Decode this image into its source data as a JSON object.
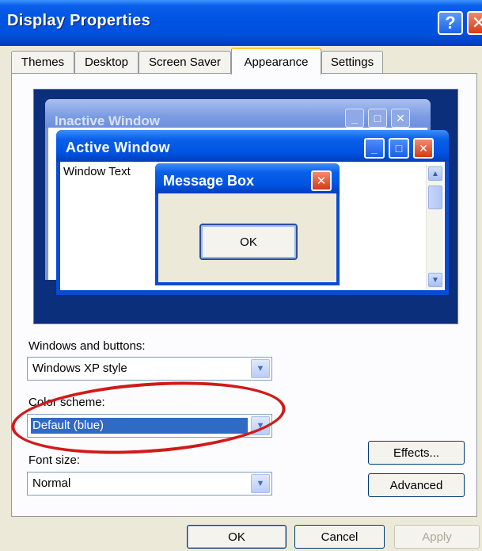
{
  "window": {
    "title": "Display Properties",
    "help_glyph": "?",
    "close_glyph": "✕"
  },
  "tabs": [
    {
      "label": "Themes"
    },
    {
      "label": "Desktop"
    },
    {
      "label": "Screen Saver"
    },
    {
      "label": "Appearance",
      "active": true
    },
    {
      "label": "Settings"
    }
  ],
  "preview": {
    "inactive_window_title": "Inactive Window",
    "active_window_title": "Active Window",
    "window_text": "Window Text",
    "message_box_title": "Message Box",
    "message_box_ok": "OK"
  },
  "form": {
    "windows_buttons_label": "Windows and buttons:",
    "windows_buttons_value": "Windows XP style",
    "color_scheme_label": "Color scheme:",
    "color_scheme_value": "Default (blue)",
    "font_size_label": "Font size:",
    "font_size_value": "Normal",
    "effects_label": "Effects...",
    "advanced_label": "Advanced"
  },
  "dialog_buttons": {
    "ok": "OK",
    "cancel": "Cancel",
    "apply": "Apply"
  },
  "colors": {
    "titlebar_blue": "#0054e3",
    "highlight_ring": "#d11a1a",
    "selection": "#316ac5"
  }
}
